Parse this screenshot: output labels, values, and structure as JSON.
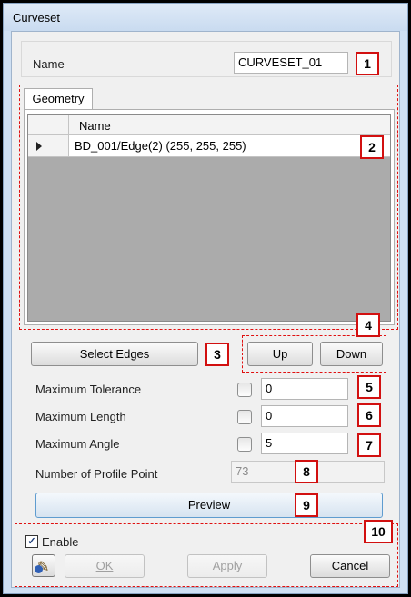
{
  "window": {
    "title": "Curveset"
  },
  "name_field": {
    "label": "Name",
    "value": "CURVESET_01"
  },
  "tabs": [
    {
      "label": "Geometry"
    }
  ],
  "grid": {
    "column_header": "Name",
    "rows": [
      {
        "value": "BD_001/Edge(2) (255, 255, 255)"
      }
    ]
  },
  "buttons": {
    "select_edges": "Select Edges",
    "up": "Up",
    "down": "Down",
    "preview": "Preview",
    "ok": "OK",
    "apply": "Apply",
    "cancel": "Cancel"
  },
  "params": {
    "max_tolerance": {
      "label": "Maximum Tolerance",
      "value": "0"
    },
    "max_length": {
      "label": "Maximum Length",
      "value": "0"
    },
    "max_angle": {
      "label": "Maximum Angle",
      "value": "5"
    },
    "profile_points": {
      "label": "Number of Profile Point",
      "value": "73"
    }
  },
  "enable": {
    "label": "Enable",
    "checked": true
  },
  "callouts": [
    "1",
    "2",
    "3",
    "4",
    "5",
    "6",
    "7",
    "8",
    "9",
    "10"
  ],
  "colors": {
    "callout": "#d21010",
    "grid_bg": "#ababab",
    "window_frame": "#cfe0f3"
  }
}
